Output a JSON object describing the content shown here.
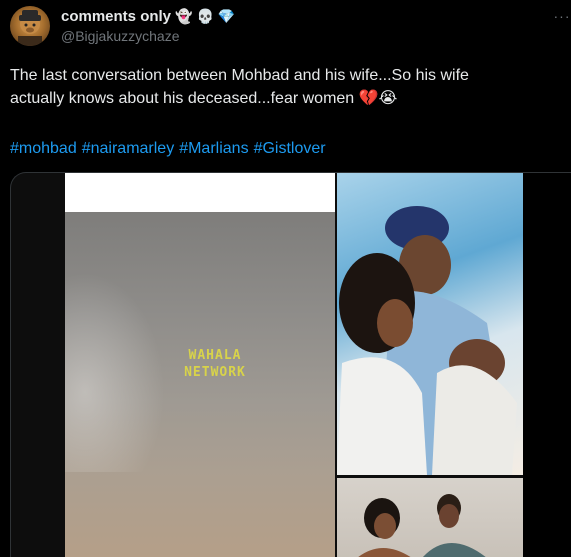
{
  "author": {
    "display_name": "comments only",
    "badges": [
      "👻",
      "💀",
      "💎"
    ],
    "handle": "@Bigjakuzzychaze",
    "avatar_icon": "avatar-image"
  },
  "tweet": {
    "text_line1": "The last conversation between Mohbad and his wife...So his wife",
    "text_line2": "actually knows about his deceased...fear women 💔😭",
    "hashtags": [
      "#mohbad",
      "#nairamarley",
      "#Marlians",
      "#Gistlover"
    ]
  },
  "media": {
    "watermark_line1": "WAHALA",
    "watermark_line2": "NETWORK"
  },
  "menu": {
    "more_icon": "more-options-icon",
    "more_label": "···"
  },
  "colors": {
    "link": "#1d9bf0",
    "secondary": "#71767b",
    "background": "#000000",
    "text": "#e7e9ea"
  }
}
